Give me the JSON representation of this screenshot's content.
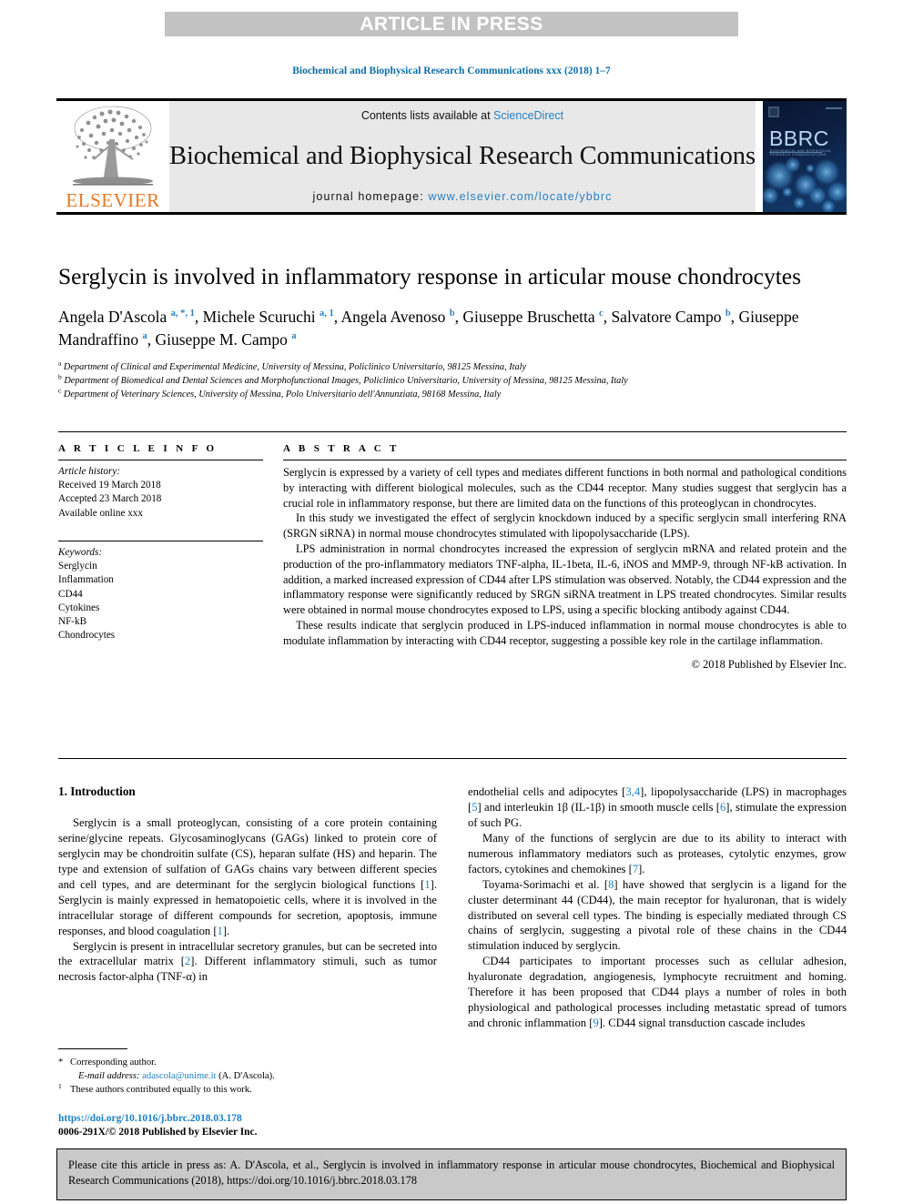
{
  "banner": {
    "text": "ARTICLE IN PRESS"
  },
  "running_head": {
    "text": "Biochemical and Biophysical Research Communications xxx (2018) 1–7"
  },
  "masthead": {
    "publisher_word": "ELSEVIER",
    "contents_prefix": "Contents lists available at ",
    "contents_link": "ScienceDirect",
    "journal_name": "Biochemical and Biophysical Research Communications",
    "homepage_label": "journal homepage: ",
    "homepage_url": "www.elsevier.com/locate/ybbrc",
    "cover_title": "BBRC",
    "cover_subtitle": "BIOCHEMICAL AND BIOPHYSICAL RESEARCH COMMUNICATIONS"
  },
  "article": {
    "title": "Serglycin is involved in inflammatory response in articular mouse chondrocytes",
    "authors_html": "Angela D'Ascola <sup>a, *, 1</sup>, Michele Scuruchi <sup>a, 1</sup>, Angela Avenoso <sup>b</sup>, Giuseppe Bruschetta <sup>c</sup>, Salvatore Campo <sup>b</sup>, Giuseppe Mandraffino <sup>a</sup>, Giuseppe M. Campo <sup>a</sup>",
    "affiliations": [
      {
        "marker": "a",
        "text": "Department of Clinical and Experimental Medicine, University of Messina, Policlinico Universitario, 98125 Messina, Italy"
      },
      {
        "marker": "b",
        "text": "Department of Biomedical and Dental Sciences and Morphofunctional Images, Policlinico Universitario, University of Messina, 98125 Messina, Italy"
      },
      {
        "marker": "c",
        "text": "Department of Veterinary Sciences, University of Messina, Polo Universitario dell'Annunziata, 98168 Messina, Italy"
      }
    ]
  },
  "article_info": {
    "heading": "A R T I C L E   I N F O",
    "history_label": "Article history:",
    "history": [
      "Received 19 March 2018",
      "Accepted 23 March 2018",
      "Available online xxx"
    ],
    "keywords_label": "Keywords:",
    "keywords": [
      "Serglycin",
      "Inflammation",
      "CD44",
      "Cytokines",
      "NF-kB",
      "Chondrocytes"
    ]
  },
  "abstract": {
    "heading": "A B S T R A C T",
    "paragraphs": [
      "Serglycin is expressed by a variety of cell types and mediates different functions in both normal and pathological conditions by interacting with different biological molecules, such as the CD44 receptor. Many studies suggest that serglycin has a crucial role in inflammatory response, but there are limited data on the functions of this proteoglycan in chondrocytes.",
      "In this study we investigated the effect of serglycin knockdown induced by a specific serglycin small interfering RNA (SRGN siRNA) in normal mouse chondrocytes stimulated with lipopolysaccharide (LPS).",
      "LPS administration in normal chondrocytes increased the expression of serglycin mRNA and related protein and the production of the pro-inflammatory mediators TNF-alpha, IL-1beta, IL-6, iNOS and MMP-9, through NF-kB activation. In addition, a marked increased expression of CD44 after LPS stimulation was observed. Notably, the CD44 expression and the inflammatory response were significantly reduced by SRGN siRNA treatment in LPS treated chondrocytes. Similar results were obtained in normal mouse chondrocytes exposed to LPS, using a specific blocking antibody against CD44.",
      "These results indicate that serglycin produced in LPS-induced inflammation in normal mouse chondrocytes is able to modulate inflammation by interacting with CD44 receptor, suggesting a possible key role in the cartilage inflammation."
    ],
    "copyright": "© 2018 Published by Elsevier Inc."
  },
  "body": {
    "section_heading": "1. Introduction",
    "left_paragraphs": [
      "Serglycin is a small proteoglycan, consisting of a core protein containing serine/glycine repeats. Glycosaminoglycans (GAGs) linked to protein core of serglycin may be chondroitin sulfate (CS), heparan sulfate (HS) and heparin. The type and extension of sulfation of GAGs chains vary between different species and cell types, and are determinant for the serglycin biological functions [1]. Serglycin is mainly expressed in hematopoietic cells, where it is involved in the intracellular storage of different compounds for secretion, apoptosis, immune responses, and blood coagulation [1].",
      "Serglycin is present in intracellular secretory granules, but can be secreted into the extracellular matrix [2]. Different inflammatory stimuli, such as tumor necrosis factor-alpha (TNF-α) in"
    ],
    "right_paragraphs": [
      "endothelial cells and adipocytes [3,4], lipopolysaccharide (LPS) in macrophages [5] and interleukin 1β (IL-1β) in smooth muscle cells [6], stimulate the expression of such PG.",
      "Many of the functions of serglycin are due to its ability to interact with numerous inflammatory mediators such as proteases, cytolytic enzymes, grow factors, cytokines and chemokines [7].",
      "Toyama-Sorimachi et al. [8] have showed that serglycin is a ligand for the cluster determinant 44 (CD44), the main receptor for hyaluronan, that is widely distributed on several cell types. The binding is especially mediated through CS chains of serglycin, suggesting a pivotal role of these chains in the CD44 stimulation induced by serglycin.",
      "CD44 participates to important processes such as cellular adhesion, hyaluronate degradation, angiogenesis, lymphocyte recruitment and homing. Therefore it has been proposed that CD44 plays a number of roles in both physiological and pathological processes including metastatic spread of tumors and chronic inflammation [9]. CD44 signal transduction cascade includes"
    ]
  },
  "footnotes": {
    "corresponding": "Corresponding author.",
    "corresponding_marker": "*",
    "email_label": "E-mail address:",
    "email": "adascola@unime.it",
    "email_suffix": "(A. D'Ascola).",
    "equal_marker": "1",
    "equal_contribution": "These authors contributed equally to this work.",
    "doi_url": "https://doi.org/10.1016/j.bbrc.2018.03.178",
    "issn_line": "0006-291X/© 2018 Published by Elsevier Inc."
  },
  "cite_box": {
    "text": "Please cite this article in press as: A. D'Ascola, et al., Serglycin is involved in inflammatory response in articular mouse chondrocytes, Biochemical and Biophysical Research Communications (2018), https://doi.org/10.1016/j.bbrc.2018.03.178"
  },
  "colors": {
    "link_blue": "#1a7fc1",
    "elsevier_orange": "#e87722",
    "banner_gray": "#c2c2c2",
    "masthead_gray": "#e8e8e8",
    "cite_box_gray": "#c9c9c9",
    "cover_navy": "#050d1e"
  }
}
